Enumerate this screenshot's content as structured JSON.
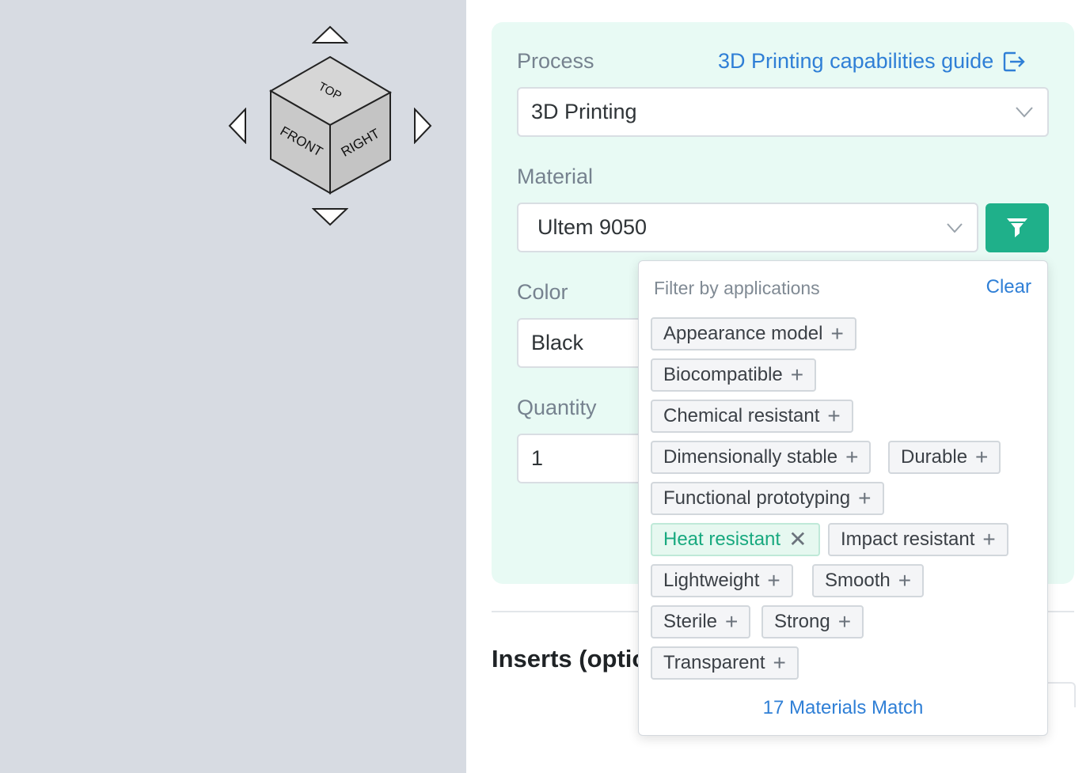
{
  "viewcube": {
    "faces": {
      "top": "TOP",
      "front": "FRONT",
      "right": "RIGHT"
    }
  },
  "config": {
    "process_label": "Process",
    "guide_link": "3D Printing capabilities guide",
    "process_value": "3D Printing",
    "material_label": "Material",
    "material_value": "Ultem 9050",
    "color_label": "Color",
    "color_value": "Black",
    "quantity_label": "Quantity",
    "quantity_value": "1"
  },
  "inserts_title": "Inserts (optional)",
  "filter_popover": {
    "title": "Filter by applications",
    "clear_label": "Clear",
    "chips": [
      {
        "label": "Appearance model",
        "mark": "+"
      },
      {
        "label": "Biocompatible",
        "mark": "+"
      },
      {
        "label": "Chemical resistant",
        "mark": "+"
      },
      {
        "label": "Dimensionally stable",
        "mark": "+"
      },
      {
        "label": "Durable",
        "mark": "+"
      },
      {
        "label": "Functional prototyping",
        "mark": "+"
      },
      {
        "label": "Heat resistant",
        "mark": "✕",
        "selected": true
      },
      {
        "label": "Impact resistant",
        "mark": "+"
      },
      {
        "label": "Lightweight",
        "mark": "+"
      },
      {
        "label": "Smooth",
        "mark": "+"
      },
      {
        "label": "Sterile",
        "mark": "+"
      },
      {
        "label": "Strong",
        "mark": "+"
      },
      {
        "label": "Transparent",
        "mark": "+"
      }
    ],
    "match_text": "17 Materials Match"
  },
  "colors": {
    "accent_green": "#1fb08a",
    "link_blue": "#2f7fd6",
    "card_bg": "#e8faf4",
    "viewport_bg": "#d7dbe2"
  },
  "icons": [
    "arrow-up-icon",
    "arrow-down-icon",
    "arrow-left-icon",
    "arrow-right-icon",
    "external-link-icon",
    "chevron-down-icon",
    "filter-icon",
    "plus-icon",
    "close-icon"
  ]
}
